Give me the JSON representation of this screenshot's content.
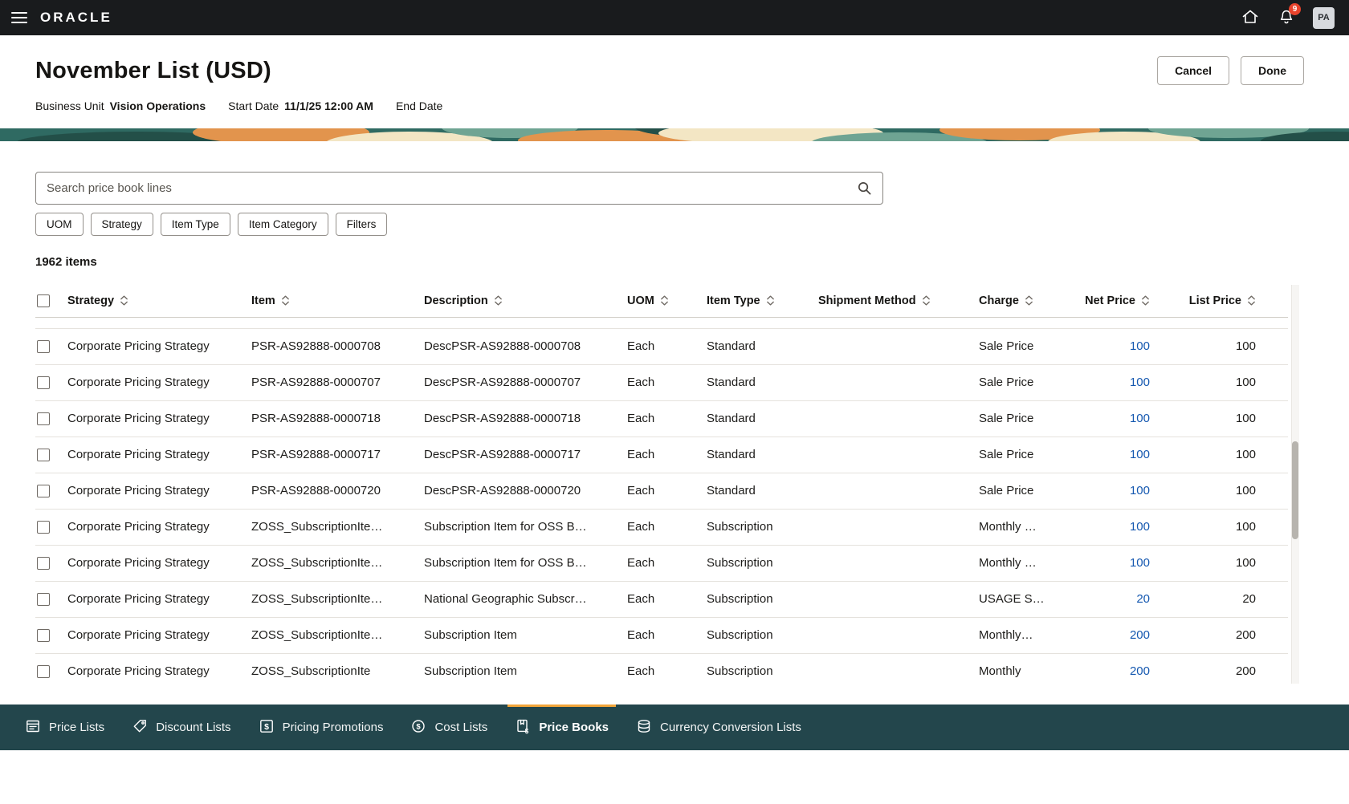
{
  "topbar": {
    "brand": "ORACLE",
    "notification_badge": "9",
    "avatar_initials": "PA"
  },
  "page_header": {
    "title": "November List (USD)",
    "buttons": {
      "cancel": "Cancel",
      "done": "Done"
    },
    "meta": {
      "business_unit_label": "Business Unit",
      "business_unit_value": "Vision Operations",
      "start_date_label": "Start Date",
      "start_date_value": "11/1/25 12:00 AM",
      "end_date_label": "End Date",
      "end_date_value": ""
    }
  },
  "toolbar": {
    "search_placeholder": "Search price book lines",
    "chips": [
      "UOM",
      "Strategy",
      "Item Type",
      "Item Category",
      "Filters"
    ],
    "items_count": "1962 items"
  },
  "table": {
    "columns": [
      {
        "key": "strategy",
        "label": "Strategy"
      },
      {
        "key": "item",
        "label": "Item"
      },
      {
        "key": "description",
        "label": "Description"
      },
      {
        "key": "uom",
        "label": "UOM"
      },
      {
        "key": "item_type",
        "label": "Item Type"
      },
      {
        "key": "shipment_method",
        "label": "Shipment Method"
      },
      {
        "key": "charge",
        "label": "Charge"
      },
      {
        "key": "net_price",
        "label": "Net Price"
      },
      {
        "key": "list_price",
        "label": "List Price"
      }
    ],
    "rows": [
      {
        "strategy": "Corporate Pricing Strategy",
        "item": "PSR-AS92888-0000708",
        "description": "DescPSR-AS92888-0000708",
        "uom": "Each",
        "item_type": "Standard",
        "shipment_method": "",
        "charge": "Sale Price",
        "net_price": "100",
        "list_price": "100"
      },
      {
        "strategy": "Corporate Pricing Strategy",
        "item": "PSR-AS92888-0000707",
        "description": "DescPSR-AS92888-0000707",
        "uom": "Each",
        "item_type": "Standard",
        "shipment_method": "",
        "charge": "Sale Price",
        "net_price": "100",
        "list_price": "100"
      },
      {
        "strategy": "Corporate Pricing Strategy",
        "item": "PSR-AS92888-0000718",
        "description": "DescPSR-AS92888-0000718",
        "uom": "Each",
        "item_type": "Standard",
        "shipment_method": "",
        "charge": "Sale Price",
        "net_price": "100",
        "list_price": "100"
      },
      {
        "strategy": "Corporate Pricing Strategy",
        "item": "PSR-AS92888-0000717",
        "description": "DescPSR-AS92888-0000717",
        "uom": "Each",
        "item_type": "Standard",
        "shipment_method": "",
        "charge": "Sale Price",
        "net_price": "100",
        "list_price": "100"
      },
      {
        "strategy": "Corporate Pricing Strategy",
        "item": "PSR-AS92888-0000720",
        "description": "DescPSR-AS92888-0000720",
        "uom": "Each",
        "item_type": "Standard",
        "shipment_method": "",
        "charge": "Sale Price",
        "net_price": "100",
        "list_price": "100"
      },
      {
        "strategy": "Corporate Pricing Strategy",
        "item": "ZOSS_SubscriptionIte…",
        "description": "Subscription Item for OSS B…",
        "uom": "Each",
        "item_type": "Subscription",
        "shipment_method": "",
        "charge": "Monthly …",
        "net_price": "100",
        "list_price": "100"
      },
      {
        "strategy": "Corporate Pricing Strategy",
        "item": "ZOSS_SubscriptionIte…",
        "description": "Subscription Item for OSS B…",
        "uom": "Each",
        "item_type": "Subscription",
        "shipment_method": "",
        "charge": "Monthly …",
        "net_price": "100",
        "list_price": "100"
      },
      {
        "strategy": "Corporate Pricing Strategy",
        "item": "ZOSS_SubscriptionIte…",
        "description": "National Geographic Subscr…",
        "uom": "Each",
        "item_type": "Subscription",
        "shipment_method": "",
        "charge": "USAGE S…",
        "net_price": "20",
        "list_price": "20"
      },
      {
        "strategy": "Corporate Pricing Strategy",
        "item": "ZOSS_SubscriptionIte…",
        "description": "Subscription Item",
        "uom": "Each",
        "item_type": "Subscription",
        "shipment_method": "",
        "charge": "Monthly…",
        "net_price": "200",
        "list_price": "200"
      },
      {
        "strategy": "Corporate Pricing Strategy",
        "item": "ZOSS_SubscriptionIte",
        "description": "Subscription Item",
        "uom": "Each",
        "item_type": "Subscription",
        "shipment_method": "",
        "charge": "Monthly",
        "net_price": "200",
        "list_price": "200"
      }
    ]
  },
  "bottom_nav": {
    "items": [
      {
        "label": "Price Lists",
        "active": false
      },
      {
        "label": "Discount Lists",
        "active": false
      },
      {
        "label": "Pricing Promotions",
        "active": false
      },
      {
        "label": "Cost Lists",
        "active": false
      },
      {
        "label": "Price Books",
        "active": true
      },
      {
        "label": "Currency Conversion Lists",
        "active": false
      }
    ]
  },
  "icons": {
    "topbar": [
      "menu-icon",
      "home-icon",
      "bell-icon"
    ],
    "search": "magnifier-icon",
    "sort": "up-down-chevrons-icon",
    "bottom_nav": [
      "price-lists-icon",
      "discount-lists-icon",
      "pricing-promotions-icon",
      "cost-lists-icon",
      "price-books-icon",
      "currency-conversion-lists-icon"
    ]
  },
  "colors": {
    "topbar_bg": "#191b1d",
    "bottombar_bg": "#23464c",
    "tab_indicator": "#f2a53a",
    "link": "#1558b0",
    "badge_bg": "#e8432c",
    "banner_teal": "#2f6a62",
    "banner_orange": "#e2944d",
    "banner_cream": "#f3e6c4",
    "banner_light_teal": "#6fa493",
    "banner_dark_teal": "#234f48"
  }
}
